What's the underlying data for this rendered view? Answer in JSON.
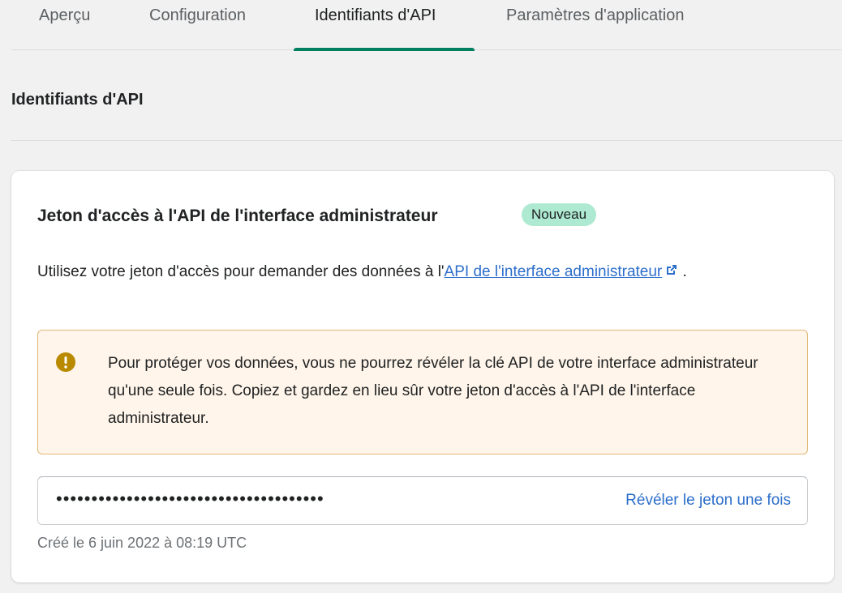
{
  "tabs": [
    {
      "label": "Aperçu",
      "active": false
    },
    {
      "label": "Configuration",
      "active": false
    },
    {
      "label": "Identifiants d'API",
      "active": true
    },
    {
      "label": "Paramètres d'application",
      "active": false
    }
  ],
  "section": {
    "title": "Identifiants d'API"
  },
  "card": {
    "title": "Jeton d'accès à l'API de l'interface administrateur",
    "badge": "Nouveau",
    "description_prefix": "Utilisez votre jeton d'accès pour demander des données à l'",
    "description_link": "API de l'interface administrateur",
    "description_suffix": " .",
    "external_link_icon": "external-link-icon",
    "banner": {
      "icon": "warning-icon",
      "text": "Pour protéger vos données, vous ne pourrez révéler la clé API de votre interface administrateur qu'une seule fois. Copiez et gardez en lieu sûr votre jeton d'accès à l'API de l'interface administrateur."
    },
    "token": {
      "masked_value": "••••••••••••••••••••••••••••••••••••••",
      "reveal_label": "Révéler le jeton une fois"
    },
    "created": "Créé le 6 juin 2022 à 08:19 UTC"
  },
  "colors": {
    "accent_tab": "#008060",
    "badge_bg": "#aee9d1",
    "link": "#2c6ecb",
    "banner_bg": "#fff5ea",
    "banner_border": "#e1b878",
    "warning_icon": "#b98900"
  }
}
